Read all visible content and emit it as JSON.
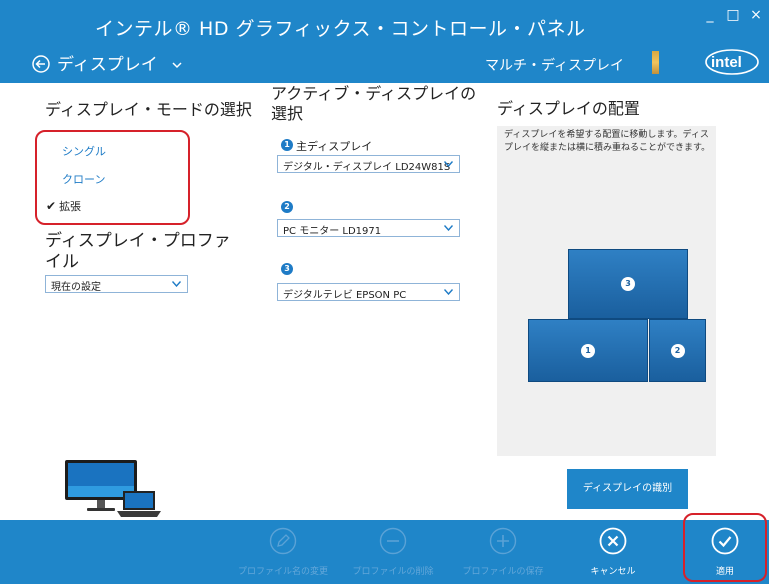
{
  "app": {
    "title": "インテル® HD グラフィックス・コントロール・パネル",
    "nav_label": "ディスプレイ",
    "section_label": "マルチ・ディスプレイ",
    "window_buttons": {
      "minimize": "_",
      "maximize": "□",
      "close": "×"
    }
  },
  "colors": {
    "accent": "#1f86c9",
    "highlight": "#d6212a",
    "panel": "#f0f0f0"
  },
  "mode": {
    "title": "ディスプレイ・モードの選択",
    "options": [
      {
        "label": "シングル",
        "selected": false
      },
      {
        "label": "クローン",
        "selected": false
      },
      {
        "label": "拡張",
        "selected": true
      }
    ],
    "check_mark": "✔"
  },
  "profile": {
    "title": "ディスプレイ・プロファイル",
    "value": "現在の設定"
  },
  "active": {
    "title": "アクティブ・ディスプレイの選択",
    "primary_label": "主ディスプレイ",
    "displays": [
      {
        "number": "1",
        "value": "デジタル・ディスプレイ LD24W81S"
      },
      {
        "number": "2",
        "value": "PC モニター LD1971"
      },
      {
        "number": "3",
        "value": "デジタルテレビ EPSON PC"
      }
    ]
  },
  "arrangement": {
    "title": "ディスプレイの配置",
    "description": "ディスプレイを希望する配置に移動します。ディスプレイを縦または横に積み重ねることができます。",
    "tiles": [
      {
        "number": "3"
      },
      {
        "number": "1"
      },
      {
        "number": "2"
      }
    ],
    "identify_label": "ディスプレイの識別"
  },
  "footer": {
    "rename": {
      "label": "プロファイル名の変更",
      "icon": "pencil-icon",
      "enabled": false
    },
    "delete": {
      "label": "プロファイルの削除",
      "icon": "minus-circle-icon",
      "enabled": false
    },
    "save": {
      "label": "プロファイルの保存",
      "icon": "plus-circle-icon",
      "enabled": false
    },
    "cancel": {
      "label": "キャンセル",
      "icon": "x-circle-icon",
      "enabled": true
    },
    "apply": {
      "label": "適用",
      "icon": "check-circle-icon",
      "enabled": true
    }
  },
  "logo": {
    "text": "intel"
  }
}
